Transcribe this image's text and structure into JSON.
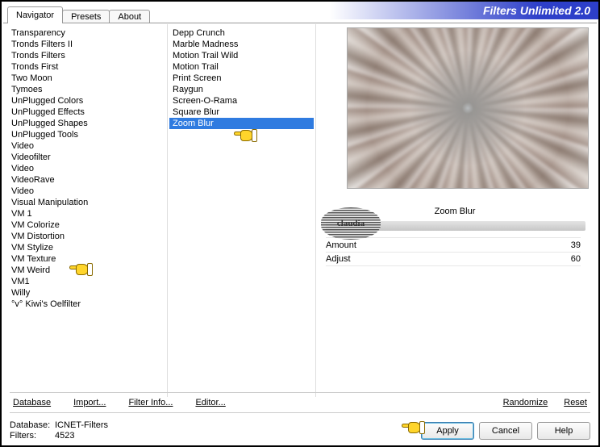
{
  "title": "Filters Unlimited 2.0",
  "tabs": [
    {
      "label": "Navigator"
    },
    {
      "label": "Presets"
    },
    {
      "label": "About"
    }
  ],
  "categories": [
    "Transparency",
    "Tronds Filters II",
    "Tronds Filters",
    "Tronds First",
    "Two Moon",
    "Tymoes",
    "UnPlugged Colors",
    "UnPlugged Effects",
    "UnPlugged Shapes",
    "UnPlugged Tools",
    "Video",
    "Videofilter",
    "Video",
    "VideoRave",
    "Video",
    "Visual Manipulation",
    "VM 1",
    "VM Colorize",
    "VM Distortion",
    "VM Stylize",
    "VM Texture",
    "VM Weird",
    "VM1",
    "Willy",
    "°v° Kiwi's Oelfilter"
  ],
  "filters": [
    "Depp Crunch",
    "Marble Madness",
    "Motion Trail Wild",
    "Motion Trail",
    "Print Screen",
    "Raygun",
    "Screen-O-Rama",
    "Square Blur",
    "Zoom Blur"
  ],
  "selected_filter": "Zoom Blur",
  "preview_label": "Zoom Blur",
  "params": [
    {
      "name": "Amount",
      "value": "39"
    },
    {
      "name": "Adjust",
      "value": "60"
    }
  ],
  "link_buttons": {
    "database": "Database",
    "import": "Import...",
    "filter_info": "Filter Info...",
    "editor": "Editor...",
    "randomize": "Randomize",
    "reset": "Reset"
  },
  "status": {
    "db_label": "Database:",
    "db_value": "ICNET-Filters",
    "filters_label": "Filters:",
    "filters_value": "4523"
  },
  "buttons": {
    "apply": "Apply",
    "cancel": "Cancel",
    "help": "Help"
  },
  "watermark": "claudia"
}
